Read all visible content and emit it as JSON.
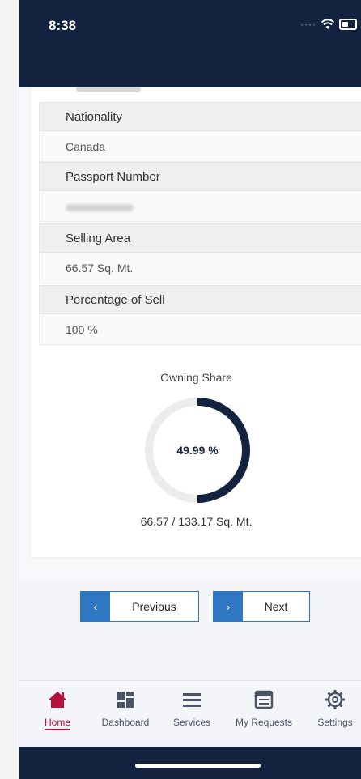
{
  "status": {
    "time": "8:38"
  },
  "fields": [
    {
      "label": "Nationality",
      "value": "Canada"
    },
    {
      "label": "Passport Number",
      "value": ""
    },
    {
      "label": "Selling Area",
      "value": "66.57 Sq. Mt."
    },
    {
      "label": "Percentage of Sell",
      "value": "100 %"
    }
  ],
  "owning_share": {
    "title": "Owning Share",
    "percent_label": "49.99 %",
    "percent": 49.99,
    "caption": "66.57 / 133.17 Sq. Mt."
  },
  "pager": {
    "previous_label": "Previous",
    "next_label": "Next",
    "previous_icon": "chevron-left-icon",
    "next_icon": "chevron-right-icon"
  },
  "tabs": [
    {
      "label": "Home",
      "icon": "home-icon",
      "active": true
    },
    {
      "label": "Dashboard",
      "icon": "dashboard-icon",
      "active": false
    },
    {
      "label": "Services",
      "icon": "menu-icon",
      "active": false
    },
    {
      "label": "My Requests",
      "icon": "requests-icon",
      "active": false
    },
    {
      "label": "Settings",
      "icon": "gear-icon",
      "active": false
    }
  ],
  "colors": {
    "navy": "#13233f",
    "accent": "#2f77c2",
    "active_tab": "#b3123b"
  }
}
